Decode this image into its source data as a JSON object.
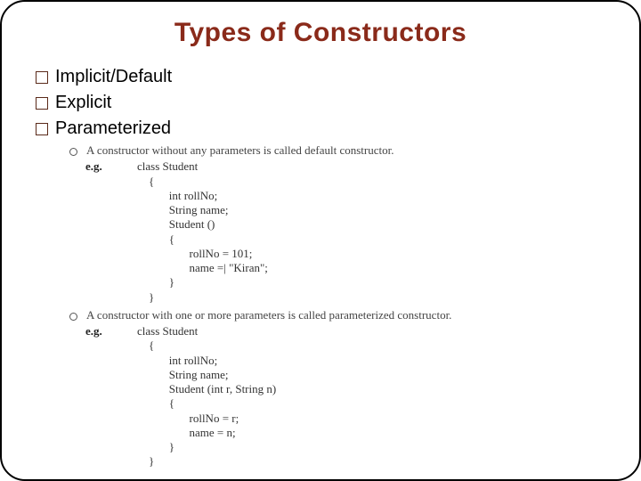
{
  "title": "Types of Constructors",
  "bullets": {
    "b1": "Implicit/Default",
    "b2": "Explicit",
    "b3": "Parameterized"
  },
  "sections": {
    "s1": {
      "def": "A constructor without any parameters is called default constructor.",
      "eg": "e.g.",
      "code": "class Student\n    {\n           int rollNo;\n           String name;\n           Student ()\n           {\n                  rollNo = 101;\n                  name =| \"Kiran\";\n           }\n    }"
    },
    "s2": {
      "def": "A constructor with one or more parameters is called parameterized constructor.",
      "eg": "e.g.",
      "code": "class Student\n    {\n           int rollNo;\n           String name;\n           Student (int r, String n)\n           {\n                  rollNo = r;\n                  name = n;\n           }\n    }"
    }
  }
}
